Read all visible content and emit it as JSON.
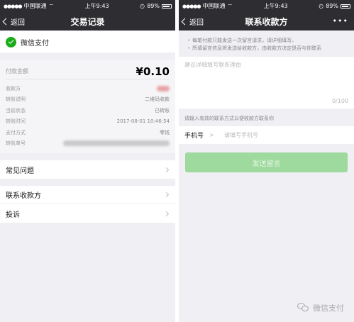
{
  "colors": {
    "nav_bg": "#2e2e32",
    "wechat_green": "#1aad19",
    "send_button_disabled": "#9ed99d",
    "page_bg": "#efeff4"
  },
  "left": {
    "status": {
      "carrier": "中国联通",
      "time": "上午9:43",
      "battery": "89%"
    },
    "nav": {
      "back_label": "返回",
      "title": "交易记录"
    },
    "merchant": {
      "name": "微信支付",
      "icon": "wechat-pay-icon"
    },
    "amount": {
      "label": "付款金额",
      "value": "¥0.10"
    },
    "details": [
      {
        "label": "收款方",
        "value": ""
      },
      {
        "label": "转账说明",
        "value": "二维码收款"
      },
      {
        "label": "当前状态",
        "value": "已转账"
      },
      {
        "label": "转账时间",
        "value": "2017-08-01 10:46:54"
      },
      {
        "label": "支付方式",
        "value": "零钱"
      },
      {
        "label": "转账单号",
        "value": ""
      }
    ],
    "menu_faq": "常见问题",
    "menu_contact": "联系收款方",
    "menu_complain": "投诉"
  },
  "right": {
    "status": {
      "carrier": "中国联通",
      "time": "上午9:43",
      "battery": "89%"
    },
    "nav": {
      "back_label": "返回",
      "title": "联系收款方",
      "more": "•••"
    },
    "notices": [
      "每笔付款只能发送一次留言请求，请详细填写。",
      "所填留言信息将发送给收款方，由收款方决定是否与你联系"
    ],
    "textarea": {
      "placeholder": "建议详细填写联系理由",
      "counter": "0/100"
    },
    "contact_hint": "请输入有效的联系方式以便收款方联系你",
    "phone": {
      "label": "手机号",
      "separator": ">",
      "placeholder": "请填写手机号"
    },
    "send_button": "发送留言"
  },
  "watermark": {
    "text": "微信支付",
    "icon": "wechat-logo-icon"
  }
}
